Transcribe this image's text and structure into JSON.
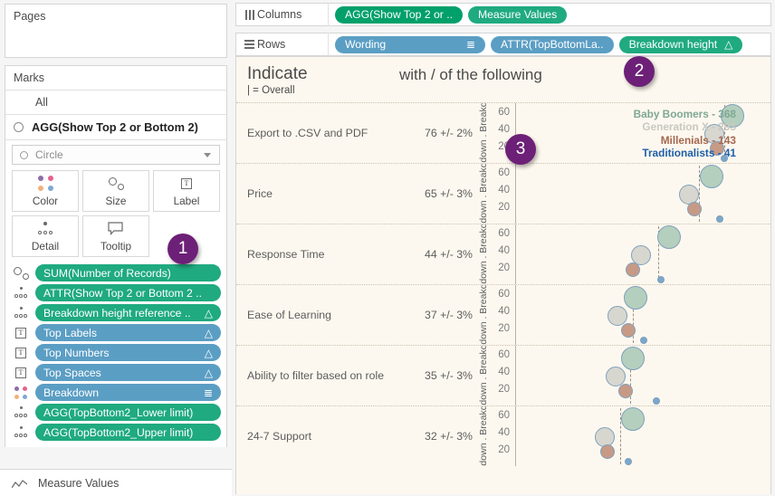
{
  "sidebar": {
    "pages": {
      "title": "Pages"
    },
    "marks": {
      "title": "Marks",
      "all_tab": "All",
      "layer_label": "AGG(Show Top 2 or Bottom 2)",
      "mark_type": "Circle",
      "encodings": [
        {
          "label": "Color",
          "icon": "color-dots-icon"
        },
        {
          "label": "Size",
          "icon": "size-bubbles-icon"
        },
        {
          "label": "Label",
          "icon": "label-text-icon"
        },
        {
          "label": "Detail",
          "icon": "detail-dots-icon"
        },
        {
          "label": "Tooltip",
          "icon": "tooltip-icon"
        }
      ],
      "pills": [
        {
          "text": "SUM(Number of Records)",
          "color": "green",
          "icon": "size-bubbles-icon",
          "badge": ""
        },
        {
          "text": "ATTR(Show Top 2 or Bottom 2 ..",
          "color": "green",
          "icon": "detail-dots-icon",
          "badge": ""
        },
        {
          "text": "Breakdown height reference ..",
          "color": "green",
          "icon": "detail-dots-icon",
          "badge": "△"
        },
        {
          "text": "Top Labels",
          "color": "blue",
          "icon": "label-text-icon",
          "badge": "△"
        },
        {
          "text": "Top Numbers",
          "color": "blue",
          "icon": "label-text-icon",
          "badge": "△"
        },
        {
          "text": "Top Spaces",
          "color": "blue",
          "icon": "label-text-icon",
          "badge": "△"
        },
        {
          "text": "Breakdown",
          "color": "blue",
          "icon": "color-dots-icon",
          "badge": "≣"
        },
        {
          "text": "AGG(TopBottom2_Lower limit)",
          "color": "green",
          "icon": "detail-dots-icon",
          "badge": ""
        },
        {
          "text": "AGG(TopBottom2_Upper limit)",
          "color": "green",
          "icon": "detail-dots-icon",
          "badge": ""
        }
      ]
    },
    "measure_values": {
      "label": "Measure Values",
      "icon": "line-chart-icon"
    }
  },
  "shelves": {
    "columns": {
      "label": "Columns",
      "icon": "columns-icon",
      "pills": [
        {
          "text": "AGG(Show Top 2 or ..",
          "color": "dgreen",
          "badge": ""
        },
        {
          "text": "Measure Values",
          "color": "green",
          "badge": ""
        }
      ]
    },
    "rows": {
      "label": "Rows",
      "icon": "rows-icon",
      "pills": [
        {
          "text": "Wording",
          "color": "blue",
          "badge": "≣"
        },
        {
          "text": "ATTR(TopBottomLa..",
          "color": "blue",
          "badge": ""
        },
        {
          "text": "Breakdown height",
          "color": "green",
          "badge": "△"
        }
      ]
    }
  },
  "viz": {
    "title_left": "Indicate",
    "subtitle_left": "| = Overall",
    "title_center": "with / of the following",
    "axis_caption": "Breakdown . Breakdown .",
    "legend": [
      {
        "label": "Baby Boomers - 368",
        "color": "#7fa893"
      },
      {
        "label": "Generation X - 293",
        "color": "#c8c8c0"
      },
      {
        "label": "Millenials - 143",
        "color": "#a5684f"
      },
      {
        "label": "Traditionalists - 41",
        "color": "#1f5fa8"
      }
    ]
  },
  "badges": [
    {
      "number": "1"
    },
    {
      "number": "2"
    },
    {
      "number": "3"
    }
  ],
  "chart_data": {
    "type": "scatter",
    "title": "Indicate with / of the following",
    "subtitle": "| = Overall",
    "xlabel": "",
    "ylabel": "Breakdown",
    "yticks": [
      20,
      40,
      60
    ],
    "ylim": [
      0,
      70
    ],
    "xlim": [
      0,
      100
    ],
    "grid": true,
    "legend_position": "top-right",
    "series": [
      {
        "name": "Baby Boomers",
        "n": 368,
        "color": "#b4cfbd",
        "size": 26
      },
      {
        "name": "Generation X",
        "n": 293,
        "color": "#d7d7cf",
        "size": 22
      },
      {
        "name": "Millenials",
        "n": 143,
        "color": "#c79a85",
        "size": 16
      },
      {
        "name": "Traditionalists",
        "n": 41,
        "color": "#7ba7cc",
        "size": 8
      }
    ],
    "categories": [
      "Export to .CSV and PDF",
      "Price",
      "Response Time",
      "Ease of Learning",
      "Ability to filter based on role",
      "24-7 Support"
    ],
    "overall_values": [
      76,
      65,
      44,
      37,
      35,
      32
    ],
    "overall_margins": [
      "2%",
      "3%",
      "3%",
      "3%",
      "3%",
      "3%"
    ],
    "rows": [
      {
        "category": "Export to .CSV and PDF",
        "overall_label": "76 +/- 2%",
        "reference_x": 82,
        "points": [
          {
            "series": "Baby Boomers",
            "x": 85,
            "y": 55
          },
          {
            "series": "Generation X",
            "x": 78,
            "y": 35
          },
          {
            "series": "Millenials",
            "x": 79,
            "y": 18
          },
          {
            "series": "Traditionalists",
            "x": 82,
            "y": 6
          }
        ]
      },
      {
        "category": "Price",
        "overall_label": "65 +/- 3%",
        "reference_x": 72,
        "points": [
          {
            "series": "Baby Boomers",
            "x": 77,
            "y": 55
          },
          {
            "series": "Generation X",
            "x": 68,
            "y": 35
          },
          {
            "series": "Millenials",
            "x": 70,
            "y": 18
          },
          {
            "series": "Traditionalists",
            "x": 80,
            "y": 6
          }
        ]
      },
      {
        "category": "Response Time",
        "overall_label": "44 +/- 3%",
        "reference_x": 56,
        "points": [
          {
            "series": "Baby Boomers",
            "x": 60,
            "y": 55
          },
          {
            "series": "Generation X",
            "x": 49,
            "y": 35
          },
          {
            "series": "Millenials",
            "x": 46,
            "y": 18
          },
          {
            "series": "Traditionalists",
            "x": 57,
            "y": 6
          }
        ]
      },
      {
        "category": "Ease of Learning",
        "overall_label": "37 +/- 3%",
        "reference_x": 46,
        "points": [
          {
            "series": "Baby Boomers",
            "x": 47,
            "y": 55
          },
          {
            "series": "Generation X",
            "x": 40,
            "y": 35
          },
          {
            "series": "Millenials",
            "x": 44,
            "y": 18
          },
          {
            "series": "Traditionalists",
            "x": 50,
            "y": 6
          }
        ]
      },
      {
        "category": "Ability to filter based on role",
        "overall_label": "35 +/- 3%",
        "reference_x": 45,
        "points": [
          {
            "series": "Baby Boomers",
            "x": 46,
            "y": 55
          },
          {
            "series": "Generation X",
            "x": 39,
            "y": 35
          },
          {
            "series": "Millenials",
            "x": 43,
            "y": 18
          },
          {
            "series": "Traditionalists",
            "x": 55,
            "y": 6
          }
        ]
      },
      {
        "category": "24-7 Support",
        "overall_label": "32 +/- 3%",
        "reference_x": 41,
        "points": [
          {
            "series": "Baby Boomers",
            "x": 46,
            "y": 55
          },
          {
            "series": "Generation X",
            "x": 35,
            "y": 35
          },
          {
            "series": "Millenials",
            "x": 36,
            "y": 18
          },
          {
            "series": "Traditionalists",
            "x": 44,
            "y": 6
          }
        ]
      }
    ]
  }
}
